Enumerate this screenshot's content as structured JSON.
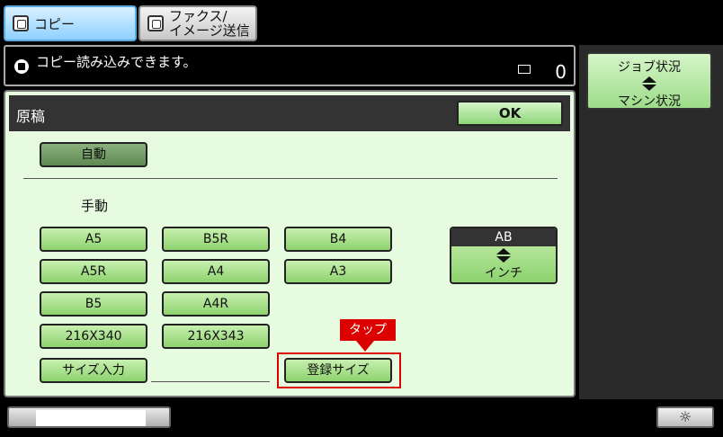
{
  "tabs": {
    "copy": "コピー",
    "fax_line1": "ファクス/",
    "fax_line2": "イメージ送信"
  },
  "status": {
    "message": "コピー読み込みできます。",
    "count": "0"
  },
  "side": {
    "job_status": "ジョブ状況",
    "machine_status": "マシン状況"
  },
  "panel": {
    "title": "原稿",
    "ok": "OK",
    "auto": "自動",
    "manual_label": "手動",
    "sizes": [
      "A5",
      "B5R",
      "B4",
      "A5R",
      "A4",
      "A3",
      "B5",
      "A4R",
      "216X340",
      "216X343"
    ],
    "size_input": "サイズ入力",
    "registered_size": "登録サイズ",
    "unit_top": "AB",
    "unit_bottom": "インチ"
  },
  "annotation": {
    "tap": "タップ"
  },
  "bottom": {
    "brightness_icon": "sun-icon"
  },
  "colors": {
    "accent_green": "#8dd26e",
    "highlight_red": "#dd0000",
    "tab_blue": "#8fd0ff"
  }
}
